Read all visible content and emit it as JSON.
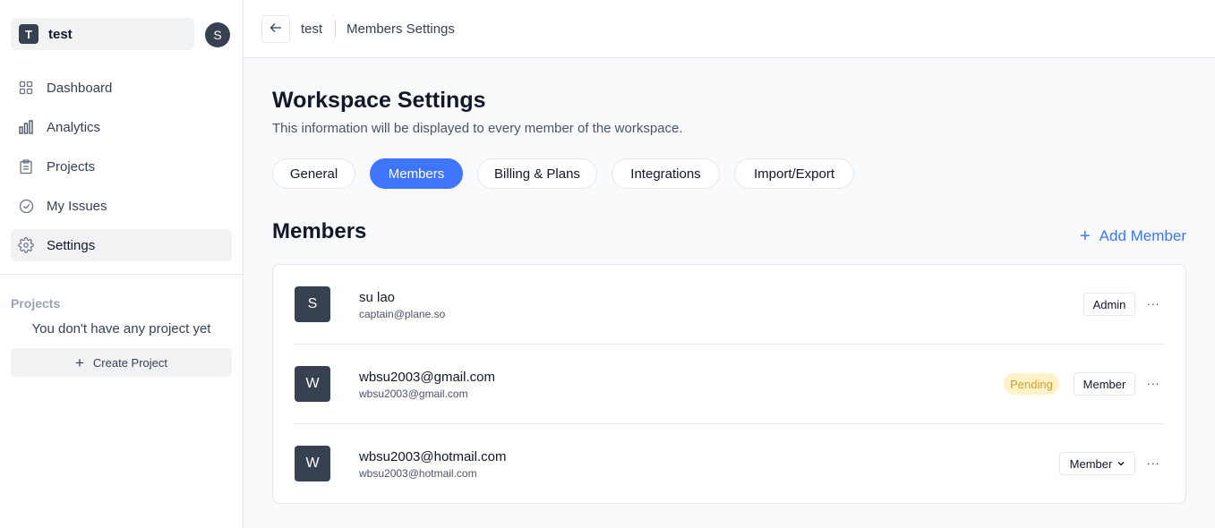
{
  "sidebar": {
    "workspace": {
      "initial": "T",
      "name": "test"
    },
    "user_initial": "S",
    "nav": [
      {
        "label": "Dashboard",
        "icon": "grid-icon"
      },
      {
        "label": "Analytics",
        "icon": "bar-chart-icon"
      },
      {
        "label": "Projects",
        "icon": "clipboard-icon"
      },
      {
        "label": "My Issues",
        "icon": "check-circle-icon"
      },
      {
        "label": "Settings",
        "icon": "gear-icon",
        "active": true
      }
    ],
    "projects_title": "Projects",
    "projects_empty": "You don't have any project yet",
    "create_project": "Create Project"
  },
  "header": {
    "back_icon": "arrow-left-icon",
    "workspace": "test",
    "page": "Members Settings"
  },
  "main": {
    "title": "Workspace Settings",
    "subtitle": "This information will be displayed to every member of the workspace.",
    "tabs": [
      {
        "label": "General"
      },
      {
        "label": "Members",
        "active": true
      },
      {
        "label": "Billing & Plans"
      },
      {
        "label": "Integrations"
      },
      {
        "label": "Import/Export"
      }
    ],
    "section_title": "Members",
    "add_member": "Add Member",
    "members": [
      {
        "initial": "S",
        "name": "su lao",
        "email": "captain@plane.so",
        "role": "Admin",
        "status": ""
      },
      {
        "initial": "W",
        "name": "wbsu2003@gmail.com",
        "email": "wbsu2003@gmail.com",
        "role": "Member",
        "status": "Pending"
      },
      {
        "initial": "W",
        "name": "wbsu2003@hotmail.com",
        "email": "wbsu2003@hotmail.com",
        "role": "Member",
        "status": ""
      }
    ]
  },
  "colors": {
    "accent": "#3f76ff",
    "avatar_bg": "#374151",
    "pending_bg": "#fdf2c8",
    "pending_text": "#d99f2c"
  }
}
